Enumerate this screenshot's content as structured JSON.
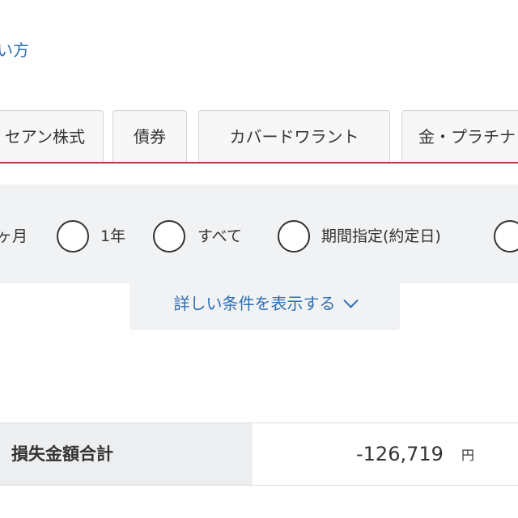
{
  "header": {
    "link_text": "い方"
  },
  "tabs": [
    {
      "label": "セアン株式"
    },
    {
      "label": "債券"
    },
    {
      "label": "カバードワラント"
    },
    {
      "label": "金・プラチナ"
    }
  ],
  "filters": {
    "periods": [
      {
        "label": "ヶ月"
      },
      {
        "label": "1年"
      },
      {
        "label": "すべて"
      },
      {
        "label": "期間指定(約定日)"
      }
    ],
    "detail_toggle_label": "詳しい条件を表示する"
  },
  "summary": {
    "label": "損失金額合計",
    "amount": "-126,719",
    "unit": "円"
  }
}
